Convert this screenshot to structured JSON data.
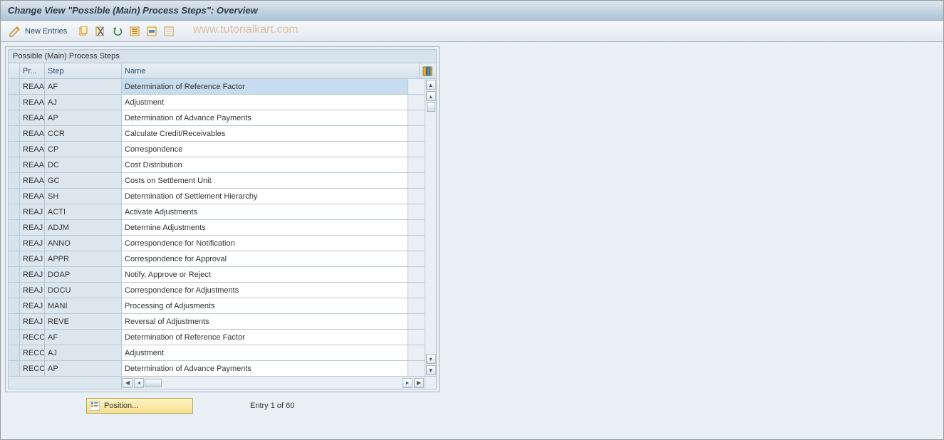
{
  "title": "Change View \"Possible (Main) Process Steps\": Overview",
  "toolbar": {
    "new_entries_label": "New Entries"
  },
  "watermark": "www.tutorialkart.com",
  "panel": {
    "title": "Possible (Main) Process Steps",
    "headers": {
      "pr": "Pr...",
      "step": "Step",
      "name": "Name"
    }
  },
  "rows": [
    {
      "pr": "REAA",
      "step": "AF",
      "name": "Determination of Reference Factor",
      "selected": true
    },
    {
      "pr": "REAA",
      "step": "AJ",
      "name": "Adjustment"
    },
    {
      "pr": "REAA",
      "step": "AP",
      "name": "Determination of Advance Payments"
    },
    {
      "pr": "REAA",
      "step": "CCR",
      "name": "Calculate Credit/Receivables"
    },
    {
      "pr": "REAA",
      "step": "CP",
      "name": "Correspondence"
    },
    {
      "pr": "REAA",
      "step": "DC",
      "name": "Cost Distribution"
    },
    {
      "pr": "REAA",
      "step": "GC",
      "name": "Costs on Settlement Unit"
    },
    {
      "pr": "REAA",
      "step": "SH",
      "name": "Determination of Settlement Hierarchy"
    },
    {
      "pr": "REAJ",
      "step": "ACTI",
      "name": "Activate Adjustments"
    },
    {
      "pr": "REAJ",
      "step": "ADJM",
      "name": "Determine Adjustments"
    },
    {
      "pr": "REAJ",
      "step": "ANNO",
      "name": "Correspondence for Notification"
    },
    {
      "pr": "REAJ",
      "step": "APPR",
      "name": "Correspondence for Approval"
    },
    {
      "pr": "REAJ",
      "step": "DOAP",
      "name": "Notify, Approve or Reject"
    },
    {
      "pr": "REAJ",
      "step": "DOCU",
      "name": "Correspondence for Adjustments"
    },
    {
      "pr": "REAJ",
      "step": "MANI",
      "name": "Processing of Adjusments"
    },
    {
      "pr": "REAJ",
      "step": "REVE",
      "name": "Reversal of Adjustments"
    },
    {
      "pr": "RECO",
      "step": "AF",
      "name": "Determination of Reference Factor"
    },
    {
      "pr": "RECO",
      "step": "AJ",
      "name": "Adjustment"
    },
    {
      "pr": "RECO",
      "step": "AP",
      "name": "Determination of Advance Payments"
    }
  ],
  "footer": {
    "position_label": "Position...",
    "entry_text": "Entry 1 of 60"
  }
}
